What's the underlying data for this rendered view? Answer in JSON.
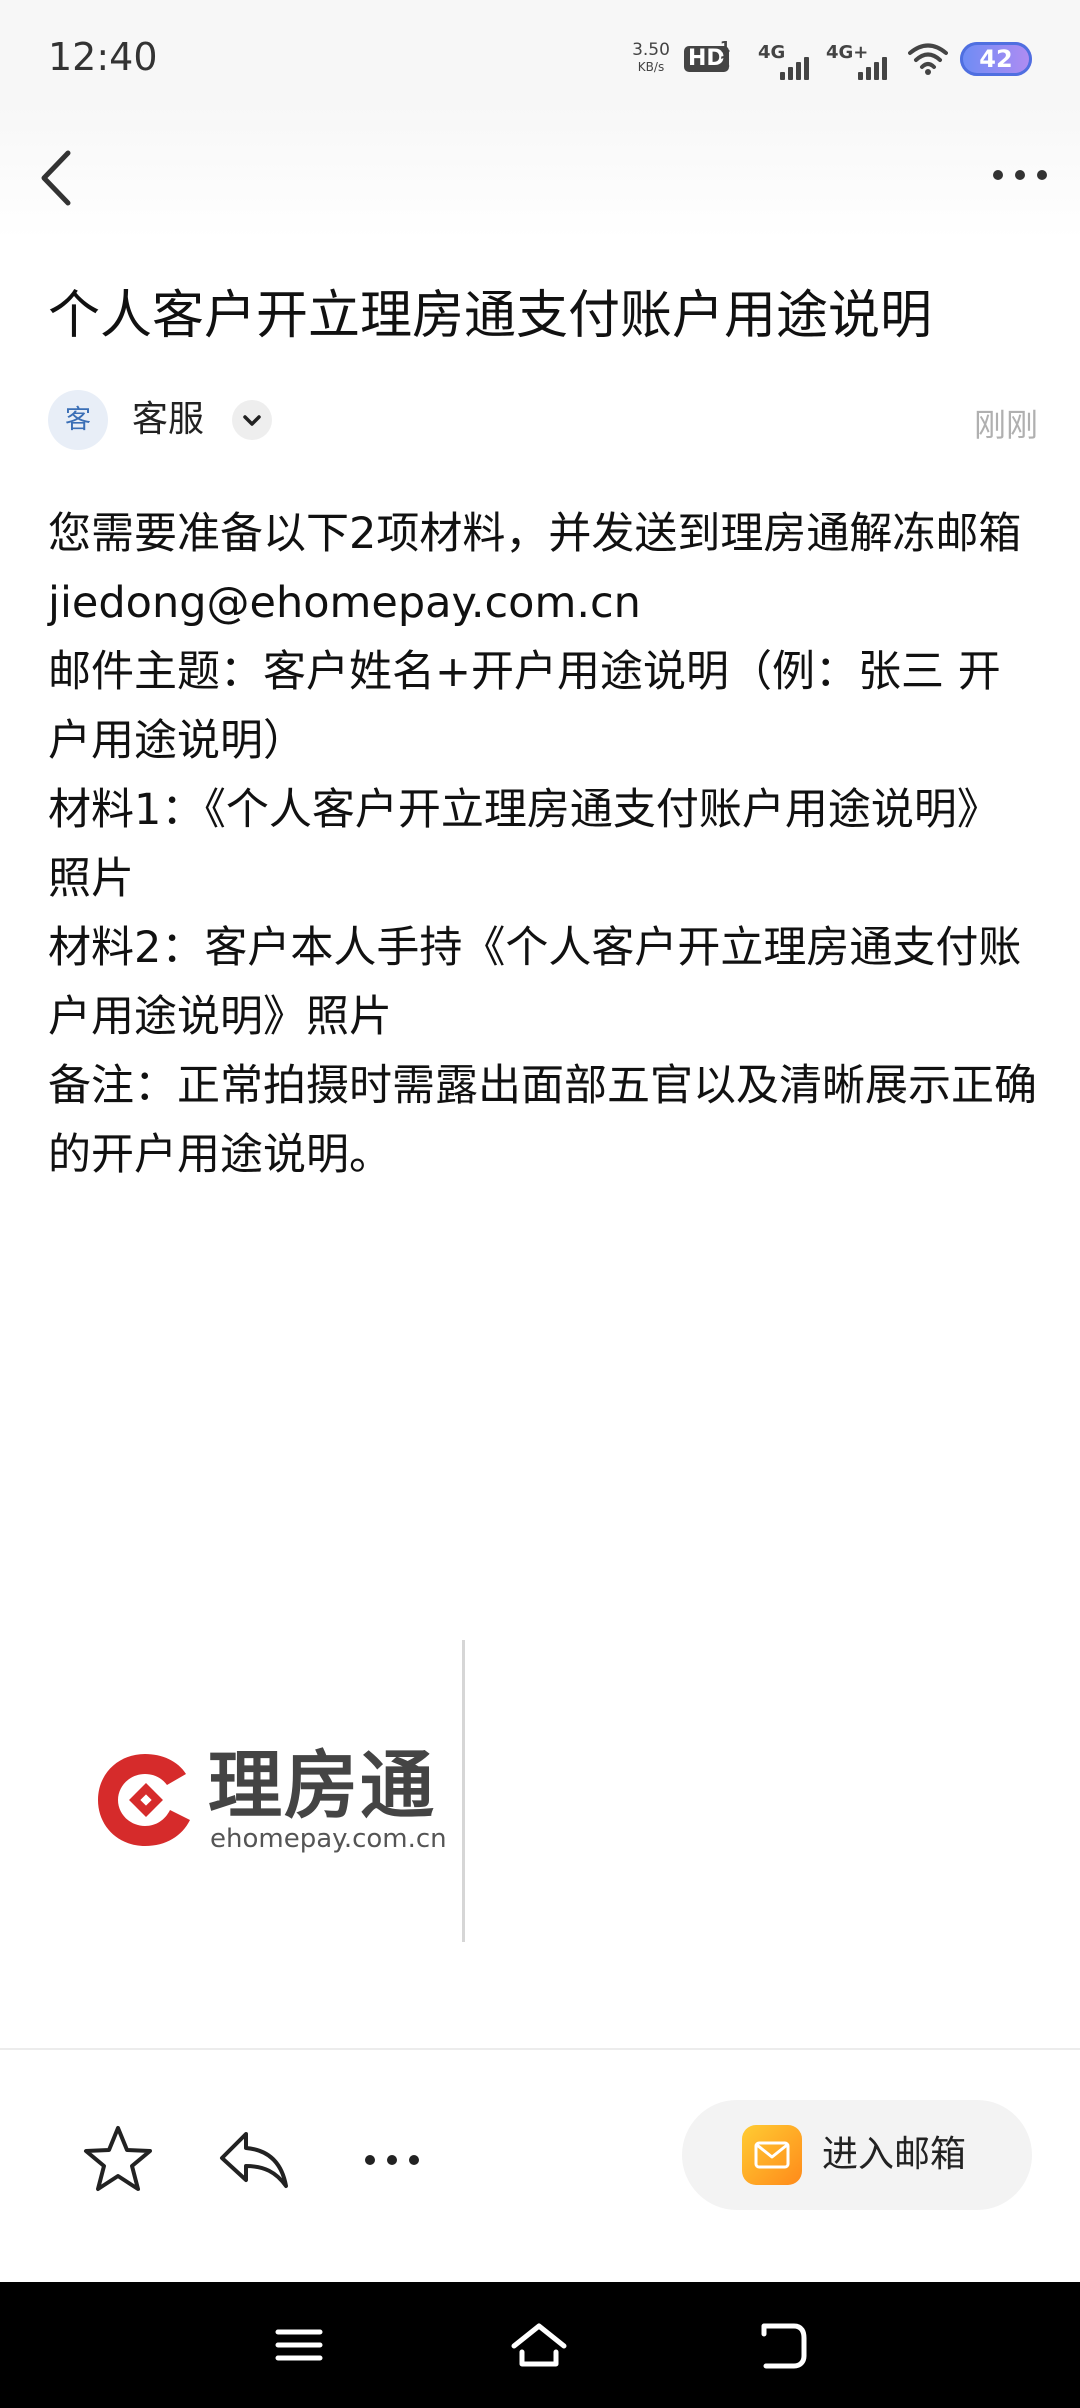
{
  "status_bar": {
    "time": "12:40",
    "net_speed_value": "3.50",
    "net_speed_unit": "KB/s",
    "hd_label": "HD",
    "hd_sub": "1\n2",
    "signal1_label": "4G",
    "signal2_label": "4G+",
    "battery": "42",
    "icons": [
      "hd-icon",
      "signal-icon",
      "signal-icon",
      "wifi-icon",
      "battery-icon"
    ]
  },
  "nav": {
    "back_icon": "chevron-left-icon",
    "more_icon": "more-horizontal-icon"
  },
  "mail": {
    "title": "个人客户开立理房通支付账户用途说明",
    "sender": {
      "avatar_text": "客",
      "name": "客服",
      "time": "刚刚"
    },
    "body": [
      "您需要准备以下2项材料，并发送到理房通解冻邮箱jiedong@ehomepay.com.cn",
      "邮件主题：客户姓名+开户用途说明（例：张三 开户用途说明）",
      "材料1：《个人客户开立理房通支付账户用途说明》照片",
      "材料2：客户本人手持《个人客户开立理房通支付账户用途说明》照片",
      "备注：正常拍摄时需露出面部五官以及清晰展示正确的开户用途说明。"
    ],
    "signature": {
      "logo_text": "理房通",
      "logo_domain": "ehomepay.com.cn"
    }
  },
  "toolbar": {
    "star_icon": "star-icon",
    "reply_icon": "reply-icon",
    "more_icon": "more-horizontal-icon",
    "open_mailbox_label": "进入邮箱"
  },
  "colors": {
    "logo_red": "#d62b2b",
    "mailbox_icon_orange": "#ffa726",
    "battery_gradient_start": "#6c8cf5",
    "battery_gradient_end": "#b18cf2"
  }
}
